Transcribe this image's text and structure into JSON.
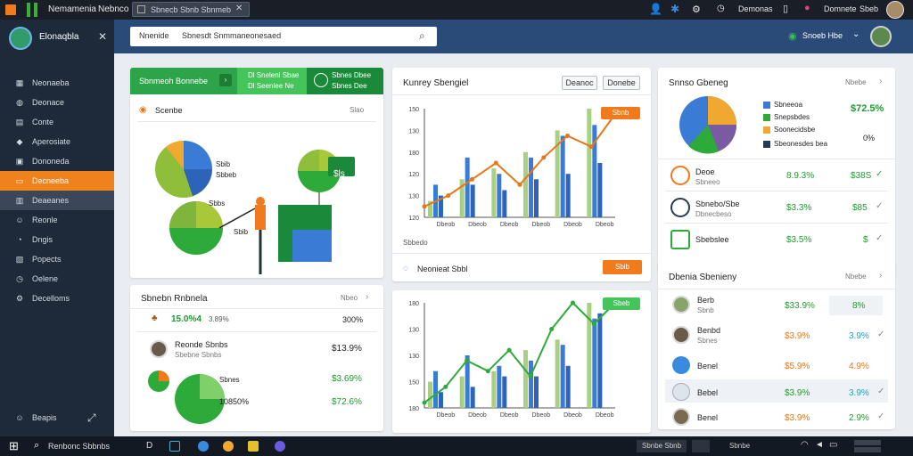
{
  "topbar": {
    "app_name": "Nemamenia",
    "menu_item": "Nebnco",
    "tab_title": "Sbnecb Sbnb Sbnmeb",
    "notif_label": "Demonas",
    "user_label": "Domnete",
    "user_count": "Sbeb"
  },
  "sidebar": {
    "brand": "Elonaqbla",
    "items": [
      {
        "label": "Neonaeba",
        "icon": "grid-icon"
      },
      {
        "label": "Deonace",
        "icon": "globe-icon"
      },
      {
        "label": "Conte",
        "icon": "document-icon"
      },
      {
        "label": "Aperosiate",
        "icon": "chat-icon"
      },
      {
        "label": "Dononeda",
        "icon": "calendar-icon"
      },
      {
        "label": "Decneeba",
        "icon": "folder-icon"
      },
      {
        "label": "Deaeanes",
        "icon": "chart-icon"
      },
      {
        "label": "Reonle",
        "icon": "user-icon"
      },
      {
        "label": "Dngis",
        "icon": "pie-icon"
      },
      {
        "label": "Popects",
        "icon": "tag-icon"
      },
      {
        "label": "Oelene",
        "icon": "clock-icon"
      },
      {
        "label": "Decelloms",
        "icon": "settings-icon"
      }
    ],
    "footer_label": "Beapis"
  },
  "header": {
    "search_prefix": "Nnenide",
    "search_value": "Sbnesdt Snmmaneonesaed",
    "user_label": "Snoeb Hbe"
  },
  "card1": {
    "tab1": "Sbnmeoh Bonnebe",
    "tab2_line1": "Dl Snelenl Sbae",
    "tab2_line2": "Dl Seenlee Ne",
    "tab3_line1": "Sbnes Dbee",
    "tab3_line2": "Sbnes Dee",
    "subtitle": "Scenbe",
    "menu": "Slao",
    "pie_label1": "Sbib",
    "pie_label2": "Sbbeb",
    "pie_label3": "Sbbs",
    "pie_label4": "Sbib",
    "badge": "$ls"
  },
  "card_mid_top": {
    "title": "Kunrey Sbengiel",
    "btn1": "Deanoc",
    "btn2": "Donebe",
    "y_ticks": [
      "150",
      "130",
      "180",
      "120",
      "130",
      "120"
    ],
    "x_ticks": [
      "Dbeob",
      "Dbeob",
      "Dbeob",
      "Dbeob",
      "Dbeob",
      "Dbeob"
    ],
    "x_extra": "Sbbedo",
    "tag": "Sbnb",
    "footer_label": "Neonieat Sbbl",
    "footer_btn": "Sbib"
  },
  "card_right_top": {
    "title": "Snnso Gbeneg",
    "menu": "Nbebe",
    "legend": [
      {
        "label": "Sbneeoa",
        "color": "#3a7bd5"
      },
      {
        "label": "Snepsbdes",
        "color": "#2eaa3a"
      },
      {
        "label": "Soonecidsbe",
        "color": "#f0a830"
      },
      {
        "label": "Sbeonesdes bea",
        "color": "#263a55"
      }
    ],
    "value1": "$72.5%",
    "value2": "0%",
    "rows": [
      {
        "title": "Deoe",
        "sub": "Sbneeo",
        "pct": "8.9.3%",
        "amt": "$38S"
      },
      {
        "title": "Sbnebo/Sbe",
        "sub": "Dbnecbeso",
        "pct": "$3.3%",
        "amt": "$85"
      },
      {
        "title": "Sbebslee",
        "sub": "",
        "pct": "$3.5%",
        "amt": "$"
      }
    ]
  },
  "card_left_bottom": {
    "title": "Sbnebn Rnbnela",
    "menu": "Nbeo",
    "row1_value": "15.0%4",
    "row1_sub": "3.89%",
    "row1_right": "300%",
    "person_title": "Reonde Sbnbs",
    "person_sub": "Sbebne Sbnbs",
    "person_value": "$13.9%",
    "row3_label": "Sbnes",
    "row3_value": "$3.69%",
    "row4_label": "10850%",
    "row4_value": "$72.6%"
  },
  "card_mid_bottom": {
    "y_ticks": [
      "180",
      "130",
      "130",
      "150",
      "180"
    ],
    "x_ticks": [
      "Dbeob",
      "Dbeob",
      "Dbeob",
      "Dbeob",
      "Dbeob",
      "Dbeob"
    ],
    "tag": "Sbeb"
  },
  "card_right_bottom": {
    "title": "Dbenia Sbenieny",
    "menu": "Nbebe",
    "rows": [
      {
        "name": "Berb",
        "sub": "Sbnb",
        "value": "$33.9%",
        "pct": "8%",
        "color": "green"
      },
      {
        "name": "Benbd",
        "sub": "Sbnes",
        "value": "$3.9%",
        "pct": "3.9%",
        "color": "orange"
      },
      {
        "name": "Benel",
        "sub": "",
        "value": "$5.9%",
        "pct": "4.9%",
        "color": "orange"
      },
      {
        "name": "Bebel",
        "sub": "",
        "value": "$3.9%",
        "pct": "3.9%",
        "color": "green"
      },
      {
        "name": "Benel",
        "sub": "",
        "value": "$3.9%",
        "pct": "2.9%",
        "color": "orange"
      }
    ]
  },
  "taskbar": {
    "search": "Renbonc Sbbnbs",
    "item1": "Sbnbe Sbnb",
    "item2": "Sbnbe"
  }
}
